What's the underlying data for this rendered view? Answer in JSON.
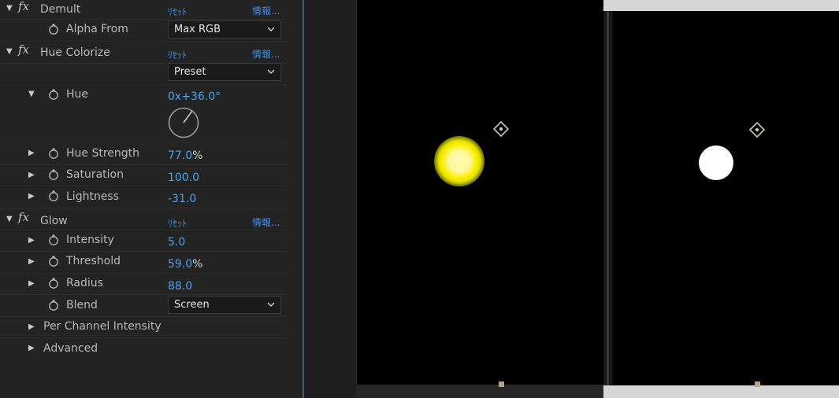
{
  "effects": {
    "demult": {
      "name": "Demult",
      "reset": "ﾘｾｯﾄ",
      "info": "情報...",
      "alpha_from_label": "Alpha From",
      "alpha_from_value": "Max RGB"
    },
    "hue_colorize": {
      "name": "Hue Colorize",
      "reset": "ﾘｾｯﾄ",
      "info": "情報...",
      "preset_value": "Preset",
      "hue_label": "Hue",
      "hue_value": "0x+36.0°",
      "hue_strength_label": "Hue Strength",
      "hue_strength_value": "77.0",
      "hue_strength_unit": "%",
      "saturation_label": "Saturation",
      "saturation_value": "100.0",
      "lightness_label": "Lightness",
      "lightness_value": "-31.0"
    },
    "glow": {
      "name": "Glow",
      "reset": "ﾘｾｯﾄ",
      "info": "情報...",
      "intensity_label": "Intensity",
      "intensity_value": "5.0",
      "threshold_label": "Threshold",
      "threshold_value": "59.0",
      "threshold_unit": "%",
      "radius_label": "Radius",
      "radius_value": "88.0",
      "blend_label": "Blend",
      "blend_value": "Screen",
      "per_channel_label": "Per Channel Intensity",
      "advanced_label": "Advanced"
    }
  },
  "icons": {
    "stopwatch": "stopwatch-icon",
    "fx": "fx-icon",
    "expand": "expand-triangle-icon",
    "dropdown": "chevron-down-icon",
    "anchor": "anchor-point-icon",
    "hue_dial": "hue-dial-icon"
  },
  "colors": {
    "value_blue": "#4ea0f0",
    "link_blue": "#3f8fe0",
    "panel_bg": "#232323",
    "glow_yellow": "#f9f000"
  }
}
